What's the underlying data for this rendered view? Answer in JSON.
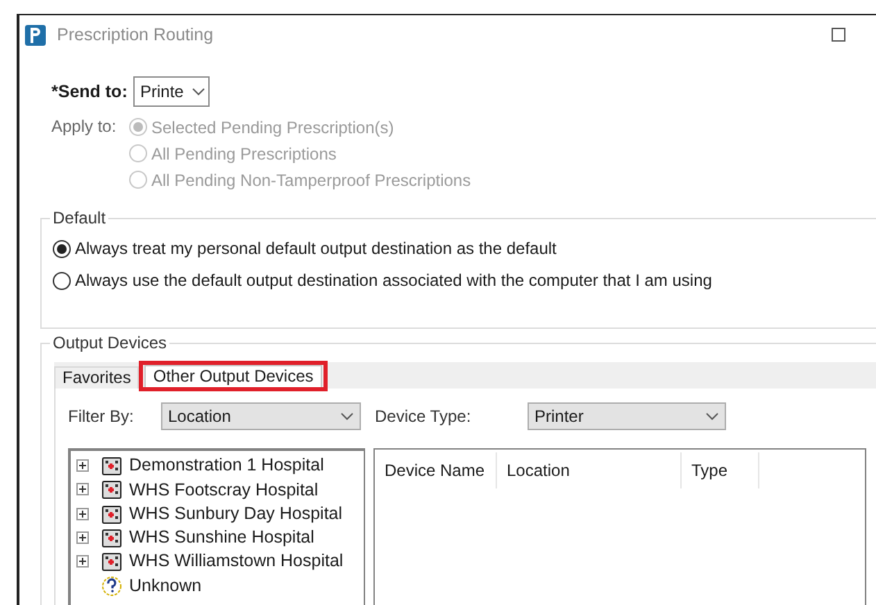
{
  "window": {
    "title": "Prescription Routing"
  },
  "send_to": {
    "label": "*Send to:",
    "value": "Printe"
  },
  "apply_to": {
    "label": "Apply to:",
    "options": [
      {
        "label": "Selected Pending Prescription(s)",
        "selected": true,
        "disabled": true
      },
      {
        "label": "All Pending Prescriptions",
        "selected": false,
        "disabled": true
      },
      {
        "label": "All Pending Non-Tamperproof Prescriptions",
        "selected": false,
        "disabled": true
      }
    ]
  },
  "default_group": {
    "title": "Default",
    "options": [
      {
        "label": "Always treat my personal default output destination as the default",
        "selected": true
      },
      {
        "label": "Always use the default output destination associated with the computer that I am using",
        "selected": false
      }
    ]
  },
  "output_devices": {
    "title": "Output Devices",
    "tabs": [
      {
        "label": "Favorites",
        "selected": false,
        "highlighted": false
      },
      {
        "label": "Other Output Devices",
        "selected": true,
        "highlighted": true
      }
    ],
    "filter_by": {
      "label": "Filter By:",
      "value": "Location"
    },
    "device_type": {
      "label": "Device Type:",
      "value": "Printer"
    },
    "tree": [
      {
        "label": "Demonstration 1 Hospital",
        "kind": "hospital",
        "expanded": false
      },
      {
        "label": "WHS Footscray Hospital",
        "kind": "hospital",
        "expanded": false
      },
      {
        "label": "WHS Sunbury Day Hospital",
        "kind": "hospital",
        "expanded": false
      },
      {
        "label": "WHS Sunshine Hospital",
        "kind": "hospital",
        "expanded": false
      },
      {
        "label": "WHS Williamstown Hospital",
        "kind": "hospital",
        "expanded": false
      },
      {
        "label": "Unknown",
        "kind": "unknown"
      }
    ],
    "device_columns": [
      "Device Name",
      "Location",
      "Type"
    ]
  }
}
